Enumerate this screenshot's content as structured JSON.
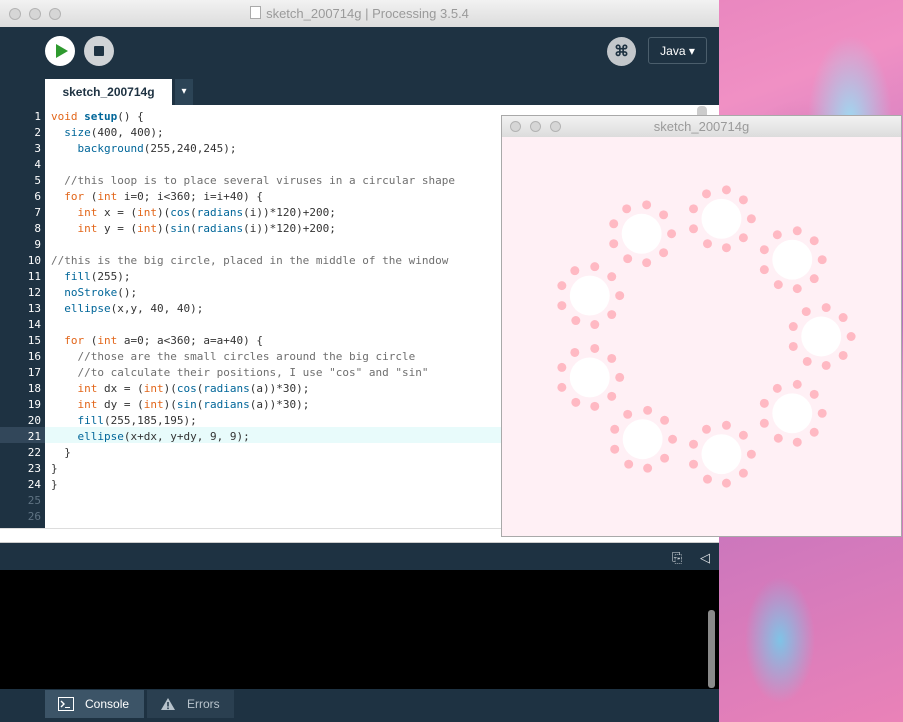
{
  "window": {
    "title": "sketch_200714g | Processing 3.5.4",
    "mode_label": "Java ▾",
    "debug_glyph": "⌘"
  },
  "tabs": [
    {
      "label": "sketch_200714g"
    }
  ],
  "tab_menu_glyph": "▾",
  "code_lines": [
    "void setup() {",
    "  size(400, 400);",
    "    background(255,240,245);",
    "",
    "  //this loop is to place several viruses in a circular shape",
    "  for (int i=0; i<360; i=i+40) {",
    "    int x = (int)(cos(radians(i))*120)+200;",
    "    int y = (int)(sin(radians(i))*120)+200;",
    "",
    "//this is the big circle, placed in the middle of the window",
    "  fill(255);",
    "  noStroke();",
    "  ellipse(x,y, 40, 40);",
    "",
    "  for (int a=0; a<360; a=a+40) {",
    "    //those are the small circles around the big circle",
    "    //to calculate their positions, I use \"cos\" and \"sin\"",
    "    int dx = (int)(cos(radians(a))*30);",
    "    int dy = (int)(sin(radians(a))*30);",
    "    fill(255,185,195);",
    "    ellipse(x+dx, y+dy, 9, 9);",
    "  }",
    "}",
    "}",
    "",
    ""
  ],
  "line_numbers": [
    "1",
    "2",
    "3",
    "4",
    "5",
    "6",
    "7",
    "8",
    "9",
    "10",
    "11",
    "12",
    "13",
    "14",
    "15",
    "16",
    "17",
    "18",
    "19",
    "20",
    "21",
    "22",
    "23",
    "24",
    "25",
    "26"
  ],
  "current_line": 21,
  "console_tabs": {
    "console": "Console",
    "errors": "Errors"
  },
  "sketch_window": {
    "title": "sketch_200714g",
    "background": "#fff0f5",
    "big_fill": "#ffffff",
    "small_fill": "#ffb9c3"
  },
  "colors": {
    "ide_bg": "#1e3242",
    "keyword": "#e2661a",
    "function": "#006699",
    "comment": "#6f6f6f",
    "run_green": "#2f9a2f"
  }
}
